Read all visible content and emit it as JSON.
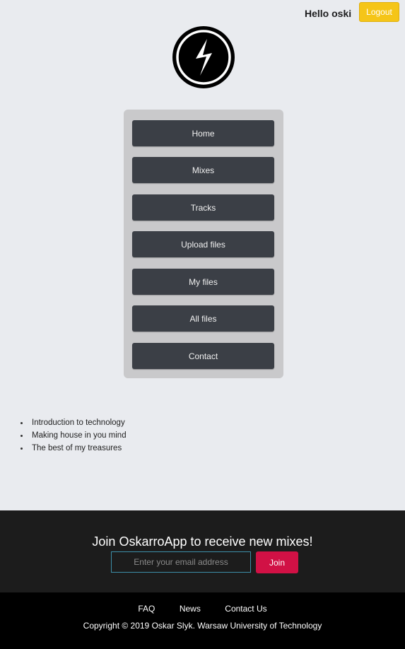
{
  "header": {
    "greeting": "Hello oski",
    "logout_label": "Logout"
  },
  "logo": {
    "icon": "lightning-bolt-icon"
  },
  "nav": {
    "items": [
      {
        "label": "Home"
      },
      {
        "label": "Mixes"
      },
      {
        "label": "Tracks"
      },
      {
        "label": "Upload files"
      },
      {
        "label": "My files"
      },
      {
        "label": "All files"
      },
      {
        "label": "Contact"
      }
    ]
  },
  "mixes": [
    "Introduction to technology",
    "Making house in you mind",
    "The best of my treasures"
  ],
  "newsletter": {
    "heading": "Join OskarroApp to receive new mixes!",
    "email_placeholder": "Enter your email address",
    "join_label": "Join"
  },
  "footer": {
    "links": [
      "FAQ",
      "News",
      "Contact Us"
    ],
    "copyright": "Copyright © 2019 Oskar Slyk. Warsaw University of Technology"
  },
  "colors": {
    "logout_bg": "#f5c518",
    "nav_button_bg": "#3b3f46",
    "join_bg": "#d11145",
    "input_border": "#3d8fa8"
  }
}
